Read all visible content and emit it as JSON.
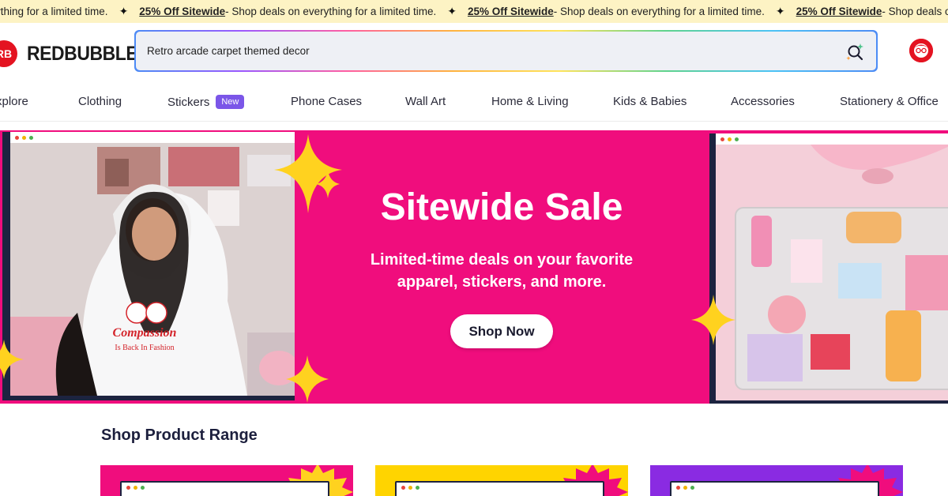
{
  "ticker": {
    "items": [
      {
        "bold": "",
        "text": "ything for a limited time."
      },
      {
        "bold": "25% Off Sitewide",
        "text": " - Shop deals on everything for a limited time."
      },
      {
        "bold": "25% Off Sitewide",
        "text": " - Shop deals on everything for a limited time."
      },
      {
        "bold": "25% Off Sitewide",
        "text": " - Shop deals on everything for a limited time."
      }
    ]
  },
  "header": {
    "logo_text": "REDBUBBLE",
    "logo_mark": "RB",
    "search_value": "Retro arcade carpet themed decor",
    "search_icon": "search-sparkle-icon",
    "avatar_icon": "user-avatar-icon"
  },
  "nav": {
    "items": [
      {
        "label": "xplore"
      },
      {
        "label": "Clothing"
      },
      {
        "label": "Stickers",
        "badge": "New"
      },
      {
        "label": "Phone Cases"
      },
      {
        "label": "Wall Art"
      },
      {
        "label": "Home & Living"
      },
      {
        "label": "Kids & Babies"
      },
      {
        "label": "Accessories"
      },
      {
        "label": "Stationery & Office"
      }
    ]
  },
  "hero": {
    "title": "Sitewide Sale",
    "subtitle": "Limited-time deals on your favorite apparel, stickers, and more.",
    "button": "Shop Now"
  },
  "section": {
    "title": "Shop Product Range"
  },
  "colors": {
    "hero_bg": "#f00d7d",
    "ticker_bg": "#fdf3c4",
    "accent_red": "#e41321",
    "badge": "#7b56e8",
    "card_pink": "#f00d7d",
    "card_yellow": "#ffd400",
    "card_purple": "#8a2be2",
    "sparkle": "#ffd21f"
  }
}
